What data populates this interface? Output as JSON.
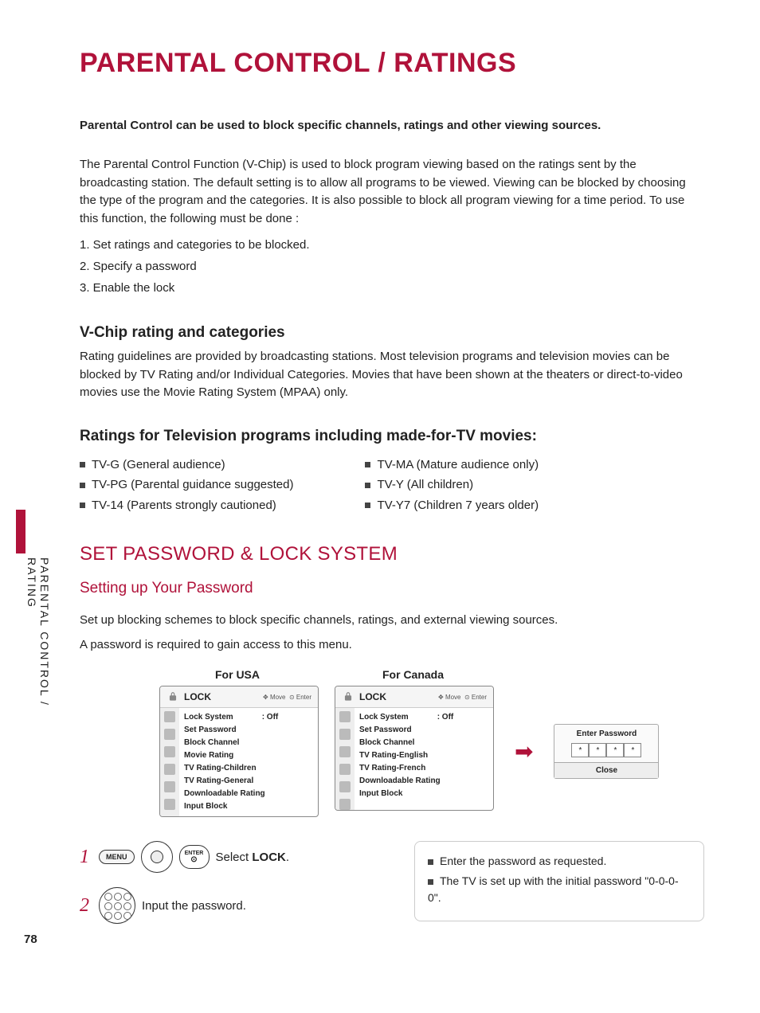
{
  "title": "PARENTAL CONTROL / RATINGS",
  "intro_bold": "Parental Control can be used to block specific channels, ratings and other viewing sources.",
  "intro_para": "The Parental Control Function (V-Chip) is used to block program viewing based on the ratings sent by the broadcasting station. The default setting is to allow all programs to be viewed. Viewing can be blocked by choosing the type of the program and the categories. It is also possible to block all program viewing for a time period. To use this function, the following must be done :",
  "numlist": [
    "1. Set ratings and categories to be blocked.",
    "2. Specify a password",
    "3. Enable the lock"
  ],
  "vchip_head": "V-Chip rating and categories",
  "vchip_para": "Rating guidelines are provided by broadcasting stations. Most television programs and television movies can be blocked by TV Rating and/or Individual Categories. Movies that have been shown at the theaters or direct-to-video movies use the Movie Rating System (MPAA) only.",
  "ratings_head": "Ratings for Television programs including made-for-TV movies:",
  "ratings_left": [
    "TV-G   (General audience)",
    "TV-PG (Parental guidance suggested)",
    "TV-14  (Parents strongly cautioned)"
  ],
  "ratings_right": [
    "TV-MA (Mature audience only)",
    "TV-Y    (All children)",
    "TV-Y7  (Children 7 years older)"
  ],
  "section_title": "SET PASSWORD & LOCK SYSTEM",
  "section_sub": "Setting up Your Password",
  "pw_para1": "Set up blocking schemes to block specific channels, ratings, and external viewing sources.",
  "pw_para2": "A password is required to gain access to this menu.",
  "usa_label": "For USA",
  "canada_label": "For Canada",
  "menu_title": "LOCK",
  "menu_hints_move": "Move",
  "menu_hints_enter": "Enter",
  "usa_items": [
    {
      "label": "Lock System",
      "value": ": Off"
    },
    {
      "label": "Set Password"
    },
    {
      "label": "Block Channel"
    },
    {
      "label": "Movie Rating"
    },
    {
      "label": "TV Rating-Children"
    },
    {
      "label": "TV Rating-General"
    },
    {
      "label": "Downloadable Rating"
    },
    {
      "label": "Input Block"
    }
  ],
  "canada_items": [
    {
      "label": "Lock System",
      "value": ": Off"
    },
    {
      "label": "Set Password"
    },
    {
      "label": "Block Channel"
    },
    {
      "label": "TV Rating-English"
    },
    {
      "label": "TV Rating-French"
    },
    {
      "label": "Downloadable Rating"
    },
    {
      "label": "Input Block"
    }
  ],
  "pwbox_title": "Enter Password",
  "pwbox_close": "Close",
  "step1_menu": "MENU",
  "step1_enter": "ENTER",
  "step1_text_a": "Select ",
  "step1_text_b": "LOCK",
  "step1_text_c": ".",
  "step2_text": "Input the password.",
  "note1": "Enter the password as requested.",
  "note2": "The TV is set up with the initial password \"0-0-0-0\".",
  "side_text": "PARENTAL CONTROL / RATING",
  "page_num": "78"
}
